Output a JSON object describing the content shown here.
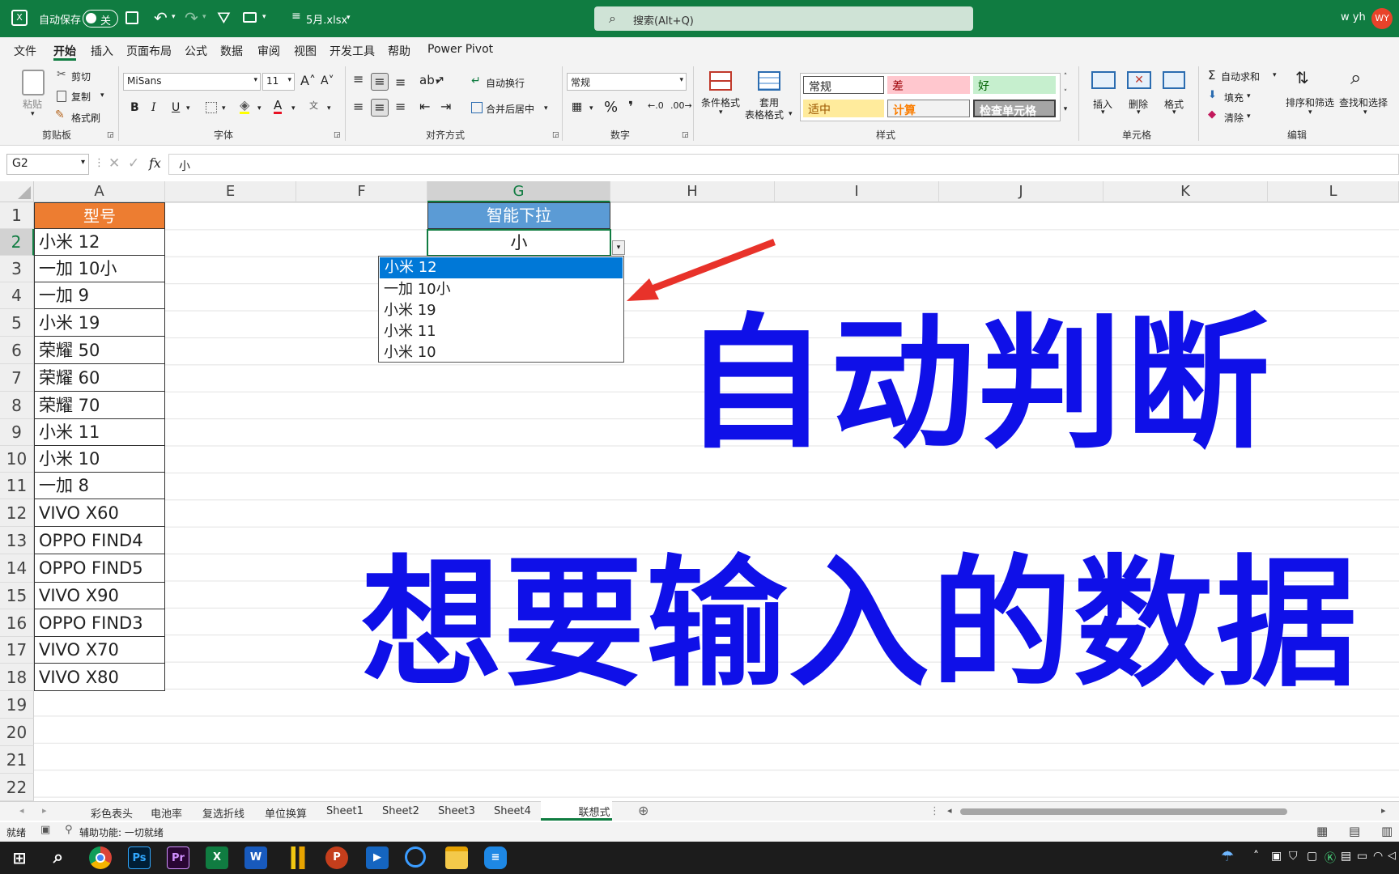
{
  "titlebar": {
    "autosave": "自动保存",
    "autosave_toggle": "关",
    "filename": "5月.xlsx",
    "search": "搜索(Alt+Q)",
    "user": "w yh",
    "avatar": "WY"
  },
  "menu": [
    "文件",
    "开始",
    "插入",
    "页面布局",
    "公式",
    "数据",
    "审阅",
    "视图",
    "开发工具",
    "帮助",
    "Power Pivot"
  ],
  "ribbon": {
    "paste": "粘贴",
    "cut": "剪切",
    "copy": "复制",
    "format_painter": "格式刷",
    "clipboard": "剪贴板",
    "font_name": "MiSans",
    "font_size": "11",
    "bold": "B",
    "italic": "I",
    "underline": "U",
    "font_group": "字体",
    "wrap": "自动换行",
    "merge": "合并后居中",
    "align_group": "对齐方式",
    "number_format": "常规",
    "percent": "%",
    "comma": "❜",
    "number_group": "数字",
    "cond_format": "条件格式",
    "table_fmt_1": "套用",
    "table_fmt_2": "表格格式",
    "style_normal": "常规",
    "style_bad": "差",
    "style_good": "好",
    "style_neutral": "适中",
    "style_calc": "计算",
    "style_check": "检查单元格",
    "styles_group": "样式",
    "insert": "插入",
    "delete": "删除",
    "format": "格式",
    "cells_group": "单元格",
    "autosum": "自动求和",
    "fill": "填充",
    "clear": "清除",
    "sort_filter": "排序和筛选",
    "find_select": "查找和选择",
    "edit_group": "编辑"
  },
  "formula_bar": {
    "name_box": "G2",
    "fx": "fx",
    "value": "小"
  },
  "columns": [
    "A",
    "E",
    "F",
    "G",
    "H",
    "I",
    "J",
    "K",
    "L"
  ],
  "rows": [
    "1",
    "2",
    "3",
    "4",
    "5",
    "6",
    "7",
    "8",
    "9",
    "10",
    "11",
    "12",
    "13",
    "14",
    "15",
    "16",
    "17",
    "18",
    "19",
    "20",
    "21",
    "22"
  ],
  "header_a": "型号",
  "header_g": "智能下拉",
  "g2_value": "小",
  "models": [
    "小米 12",
    "一加 10小",
    "一加 9",
    "小米 19",
    "荣耀 50",
    "荣耀 60",
    "荣耀 70",
    "小米 11",
    "小米 10",
    "一加 8",
    "VIVO X60",
    "OPPO FIND4",
    "OPPO FIND5",
    "VIVO X90",
    "OPPO FIND3",
    "VIVO X70",
    "VIVO X80"
  ],
  "dropdown": [
    "小米 12",
    "一加 10小",
    "小米 19",
    "小米 11",
    "小米 10"
  ],
  "overlay_line1": "自动判断",
  "overlay_line2": "想要输入的数据",
  "sheets": [
    "彩色表头",
    "电池率",
    "复选折线",
    "单位换算",
    "Sheet1",
    "Sheet2",
    "Sheet3",
    "Sheet4",
    "联想式下拉"
  ],
  "status": {
    "ready": "就绪",
    "accessibility": "辅助功能: 一切就绪"
  },
  "taskbar_apps": [
    "Ps",
    "Pr",
    "X",
    "W",
    "P"
  ],
  "colors": {
    "excel_green": "#107c41",
    "header_orange": "#ed7d31",
    "header_blue": "#5b9bd5",
    "overlay_blue": "#0f10e8",
    "select_blue": "#0078d7",
    "arrow_red": "#e8322a"
  }
}
